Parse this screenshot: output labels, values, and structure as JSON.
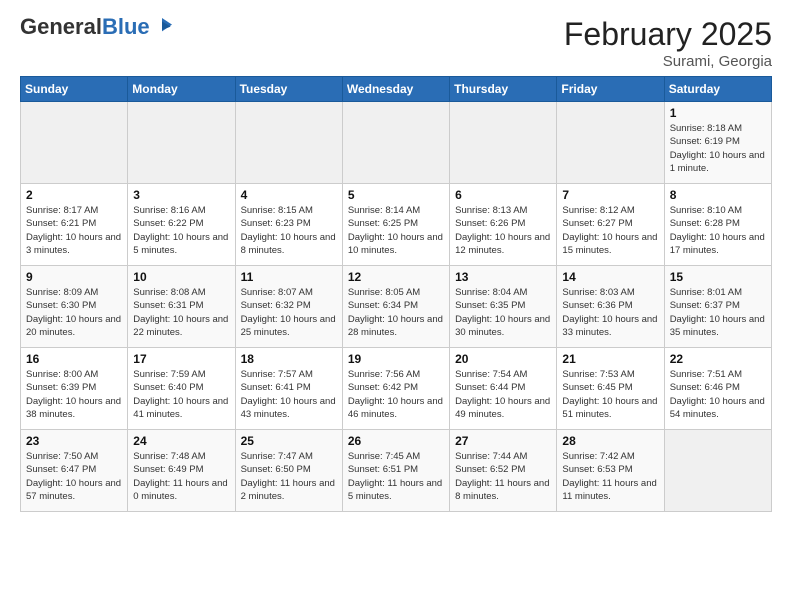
{
  "header": {
    "logo_general": "General",
    "logo_blue": "Blue",
    "month_title": "February 2025",
    "subtitle": "Surami, Georgia"
  },
  "weekdays": [
    "Sunday",
    "Monday",
    "Tuesday",
    "Wednesday",
    "Thursday",
    "Friday",
    "Saturday"
  ],
  "weeks": [
    [
      {
        "day": "",
        "info": ""
      },
      {
        "day": "",
        "info": ""
      },
      {
        "day": "",
        "info": ""
      },
      {
        "day": "",
        "info": ""
      },
      {
        "day": "",
        "info": ""
      },
      {
        "day": "",
        "info": ""
      },
      {
        "day": "1",
        "info": "Sunrise: 8:18 AM\nSunset: 6:19 PM\nDaylight: 10 hours and 1 minute."
      }
    ],
    [
      {
        "day": "2",
        "info": "Sunrise: 8:17 AM\nSunset: 6:21 PM\nDaylight: 10 hours and 3 minutes."
      },
      {
        "day": "3",
        "info": "Sunrise: 8:16 AM\nSunset: 6:22 PM\nDaylight: 10 hours and 5 minutes."
      },
      {
        "day": "4",
        "info": "Sunrise: 8:15 AM\nSunset: 6:23 PM\nDaylight: 10 hours and 8 minutes."
      },
      {
        "day": "5",
        "info": "Sunrise: 8:14 AM\nSunset: 6:25 PM\nDaylight: 10 hours and 10 minutes."
      },
      {
        "day": "6",
        "info": "Sunrise: 8:13 AM\nSunset: 6:26 PM\nDaylight: 10 hours and 12 minutes."
      },
      {
        "day": "7",
        "info": "Sunrise: 8:12 AM\nSunset: 6:27 PM\nDaylight: 10 hours and 15 minutes."
      },
      {
        "day": "8",
        "info": "Sunrise: 8:10 AM\nSunset: 6:28 PM\nDaylight: 10 hours and 17 minutes."
      }
    ],
    [
      {
        "day": "9",
        "info": "Sunrise: 8:09 AM\nSunset: 6:30 PM\nDaylight: 10 hours and 20 minutes."
      },
      {
        "day": "10",
        "info": "Sunrise: 8:08 AM\nSunset: 6:31 PM\nDaylight: 10 hours and 22 minutes."
      },
      {
        "day": "11",
        "info": "Sunrise: 8:07 AM\nSunset: 6:32 PM\nDaylight: 10 hours and 25 minutes."
      },
      {
        "day": "12",
        "info": "Sunrise: 8:05 AM\nSunset: 6:34 PM\nDaylight: 10 hours and 28 minutes."
      },
      {
        "day": "13",
        "info": "Sunrise: 8:04 AM\nSunset: 6:35 PM\nDaylight: 10 hours and 30 minutes."
      },
      {
        "day": "14",
        "info": "Sunrise: 8:03 AM\nSunset: 6:36 PM\nDaylight: 10 hours and 33 minutes."
      },
      {
        "day": "15",
        "info": "Sunrise: 8:01 AM\nSunset: 6:37 PM\nDaylight: 10 hours and 35 minutes."
      }
    ],
    [
      {
        "day": "16",
        "info": "Sunrise: 8:00 AM\nSunset: 6:39 PM\nDaylight: 10 hours and 38 minutes."
      },
      {
        "day": "17",
        "info": "Sunrise: 7:59 AM\nSunset: 6:40 PM\nDaylight: 10 hours and 41 minutes."
      },
      {
        "day": "18",
        "info": "Sunrise: 7:57 AM\nSunset: 6:41 PM\nDaylight: 10 hours and 43 minutes."
      },
      {
        "day": "19",
        "info": "Sunrise: 7:56 AM\nSunset: 6:42 PM\nDaylight: 10 hours and 46 minutes."
      },
      {
        "day": "20",
        "info": "Sunrise: 7:54 AM\nSunset: 6:44 PM\nDaylight: 10 hours and 49 minutes."
      },
      {
        "day": "21",
        "info": "Sunrise: 7:53 AM\nSunset: 6:45 PM\nDaylight: 10 hours and 51 minutes."
      },
      {
        "day": "22",
        "info": "Sunrise: 7:51 AM\nSunset: 6:46 PM\nDaylight: 10 hours and 54 minutes."
      }
    ],
    [
      {
        "day": "23",
        "info": "Sunrise: 7:50 AM\nSunset: 6:47 PM\nDaylight: 10 hours and 57 minutes."
      },
      {
        "day": "24",
        "info": "Sunrise: 7:48 AM\nSunset: 6:49 PM\nDaylight: 11 hours and 0 minutes."
      },
      {
        "day": "25",
        "info": "Sunrise: 7:47 AM\nSunset: 6:50 PM\nDaylight: 11 hours and 2 minutes."
      },
      {
        "day": "26",
        "info": "Sunrise: 7:45 AM\nSunset: 6:51 PM\nDaylight: 11 hours and 5 minutes."
      },
      {
        "day": "27",
        "info": "Sunrise: 7:44 AM\nSunset: 6:52 PM\nDaylight: 11 hours and 8 minutes."
      },
      {
        "day": "28",
        "info": "Sunrise: 7:42 AM\nSunset: 6:53 PM\nDaylight: 11 hours and 11 minutes."
      },
      {
        "day": "",
        "info": ""
      }
    ]
  ]
}
